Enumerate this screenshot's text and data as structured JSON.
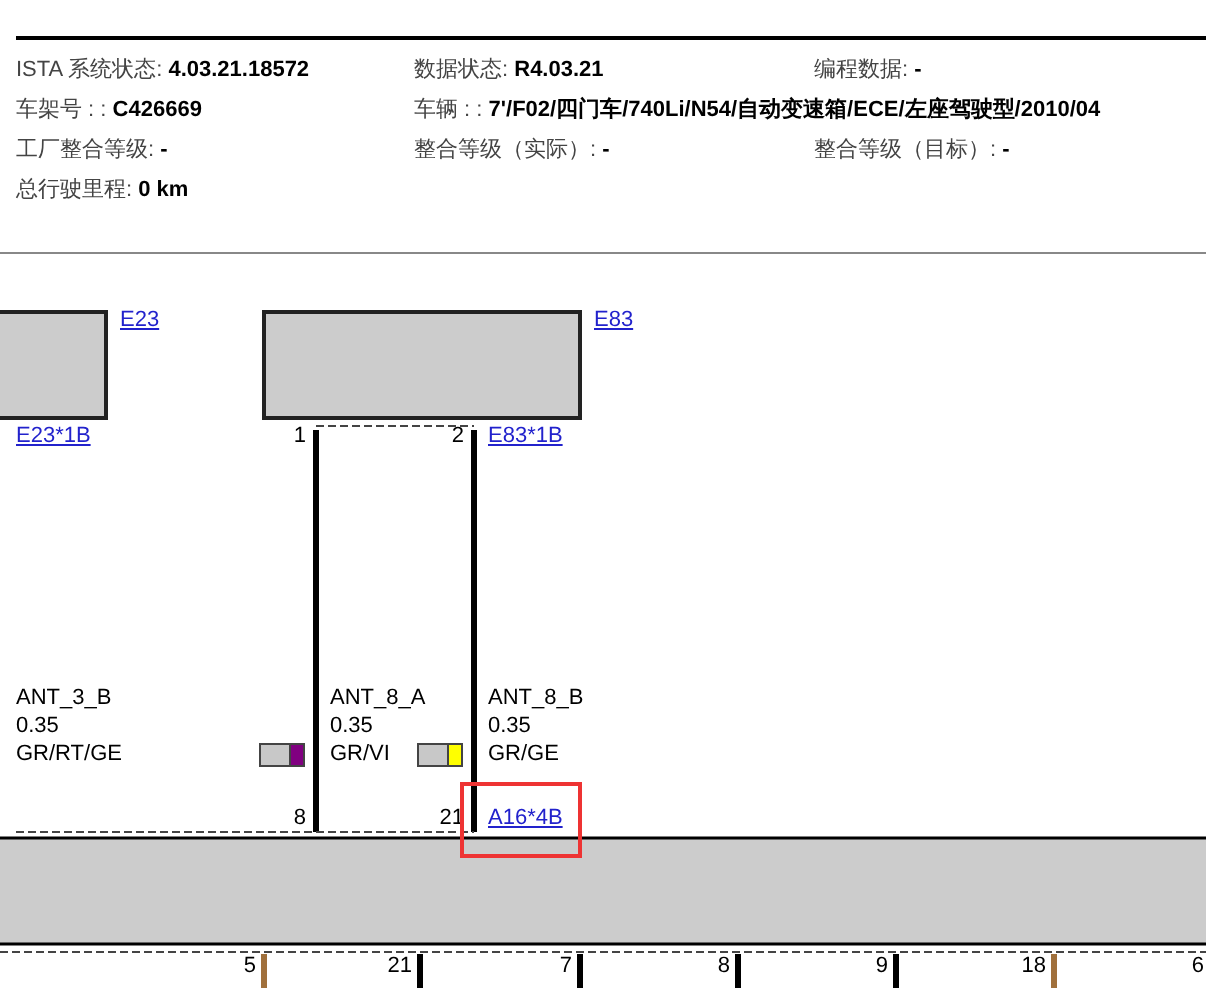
{
  "header": {
    "rows": [
      [
        {
          "label": "ISTA 系统状态: ",
          "value": "4.03.21.18572"
        },
        {
          "label": "数据状态: ",
          "value": "R4.03.21"
        },
        {
          "label": "编程数据: ",
          "value": "-"
        }
      ],
      [
        {
          "label": "车架号 : : ",
          "value": "C426669"
        },
        {
          "label": "车辆 : : ",
          "value": "7'/F02/四门车/740Li/N54/自动变速箱/ECE/左座驾驶型/2010/04"
        }
      ],
      [
        {
          "label": "工厂整合等级: ",
          "value": "-"
        },
        {
          "label": "整合等级（实际）: ",
          "value": "-"
        },
        {
          "label": "整合等级（目标）: ",
          "value": "-"
        }
      ],
      [
        {
          "label": "总行驶里程: ",
          "value": "0 km"
        }
      ]
    ]
  },
  "diagram": {
    "components": [
      {
        "name": "E23",
        "connector": "E23*1B"
      },
      {
        "name": "E83",
        "connector": "E83*1B"
      }
    ],
    "wires": [
      {
        "signal": "ANT_3_B",
        "gauge": "0.35",
        "color_code": "GR/RT/GE"
      },
      {
        "signal": "ANT_8_A",
        "gauge": "0.35",
        "color_code": "GR/VI",
        "color": "#800080",
        "top_pin": "1",
        "bottom_pin": "8"
      },
      {
        "signal": "ANT_8_B",
        "gauge": "0.35",
        "color_code": "GR/GE",
        "color": "#ffff00",
        "top_pin": "2",
        "bottom_pin": "21"
      }
    ],
    "lower_connector": {
      "label": "A16*4B",
      "highlighted": true
    },
    "lower_pins": [
      {
        "pin": "5",
        "color": "#a0703c"
      },
      {
        "pin": "21",
        "color": "#000000"
      },
      {
        "pin": "7",
        "color": "#000000"
      },
      {
        "pin": "8",
        "color": "#000000"
      },
      {
        "pin": "9",
        "color": "#000000"
      },
      {
        "pin": "18",
        "color": "#a0703c"
      },
      {
        "pin": "6"
      }
    ]
  }
}
